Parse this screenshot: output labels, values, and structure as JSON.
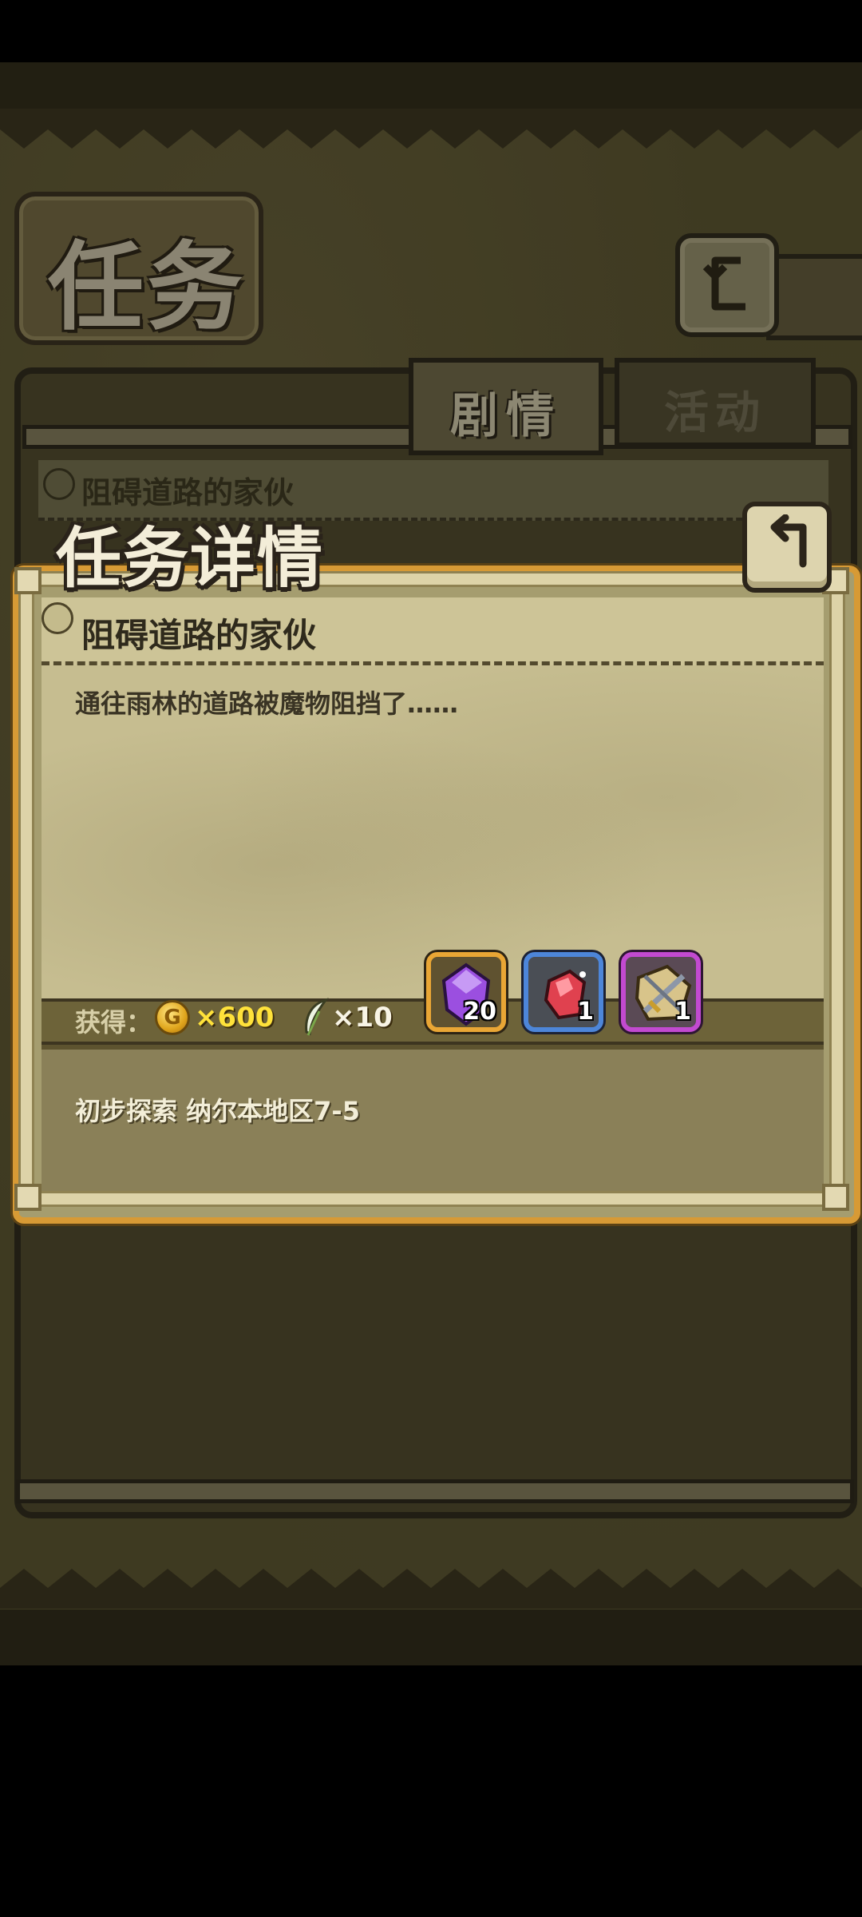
{
  "app": {
    "screen_title": "任务"
  },
  "tabs": [
    {
      "label": "剧情",
      "selected": true
    },
    {
      "label": "活动",
      "selected": false
    }
  ],
  "quest_list": {
    "items": [
      {
        "title": "阻碍道路的家伙"
      }
    ]
  },
  "modal": {
    "heading": "任务详情",
    "mission_title": "阻碍道路的家伙",
    "description": "通往雨林的道路被魔物阻挡了……",
    "rewards": {
      "label": "获得：",
      "coin_icon_letter": "G",
      "gold": "×600",
      "feather": "×10",
      "items": [
        {
          "icon": "purple-crystal-icon",
          "quantity": "20",
          "frame_color": "#e9a635"
        },
        {
          "icon": "red-shard-icon",
          "quantity": "1",
          "frame_color": "#4d86d9"
        },
        {
          "icon": "scroll-sword-icon",
          "quantity": "1",
          "frame_color": "#c24ad0"
        }
      ]
    },
    "location": "初步探索 纳尔本地区7-5"
  },
  "colors": {
    "accent_orange": "#d79a35",
    "gold_text": "#ffe23a"
  }
}
